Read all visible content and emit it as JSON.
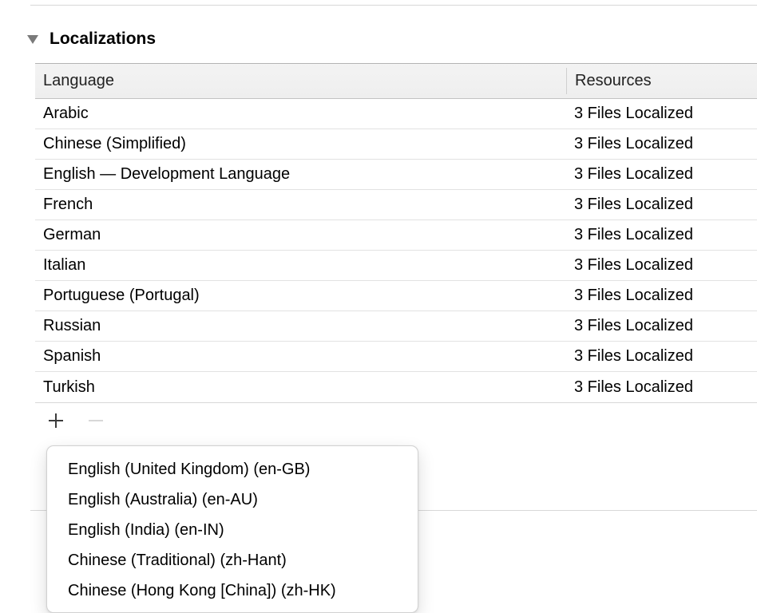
{
  "section": {
    "title": "Localizations"
  },
  "table": {
    "headers": {
      "language": "Language",
      "resources": "Resources"
    },
    "rows": [
      {
        "language": "Arabic",
        "resources": "3 Files Localized"
      },
      {
        "language": "Chinese (Simplified)",
        "resources": "3 Files Localized"
      },
      {
        "language": "English — Development Language",
        "resources": "3 Files Localized"
      },
      {
        "language": "French",
        "resources": "3 Files Localized"
      },
      {
        "language": "German",
        "resources": "3 Files Localized"
      },
      {
        "language": "Italian",
        "resources": "3 Files Localized"
      },
      {
        "language": "Portuguese (Portugal)",
        "resources": "3 Files Localized"
      },
      {
        "language": "Russian",
        "resources": "3 Files Localized"
      },
      {
        "language": "Spanish",
        "resources": "3 Files Localized"
      },
      {
        "language": "Turkish",
        "resources": "3 Files Localized"
      }
    ]
  },
  "popup": {
    "items": [
      "English (United Kingdom) (en-GB)",
      "English (Australia) (en-AU)",
      "English (India) (en-IN)",
      "Chinese (Traditional) (zh-Hant)",
      "Chinese (Hong Kong [China]) (zh-HK)"
    ]
  }
}
